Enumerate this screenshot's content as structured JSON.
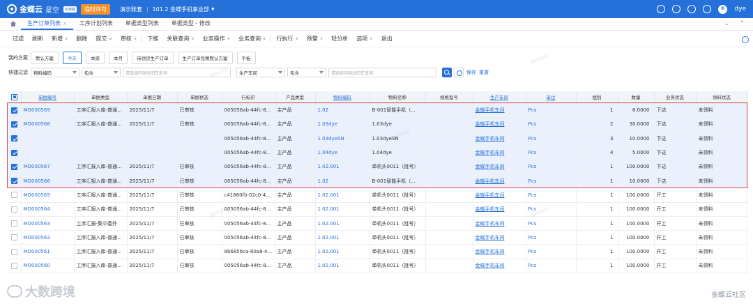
{
  "topbar": {
    "brand": "金蝶云",
    "brand_sub": "星空",
    "brand_tag": "标准版",
    "temp_badge": "临时许可",
    "account": "演示账套",
    "org": "101.2 金蝶手机事业部",
    "user": "dye"
  },
  "tabs": [
    {
      "label": "生产订单列表",
      "active": true,
      "closable": true
    },
    {
      "label": "工序计划列表",
      "active": false
    },
    {
      "label": "单据类型列表",
      "active": false
    },
    {
      "label": "单据类型 - 修改",
      "active": false
    }
  ],
  "toolbar": [
    {
      "label": "过滤"
    },
    {
      "label": "刷新"
    },
    {
      "label": "新增",
      "dropdown": true
    },
    {
      "label": "删除"
    },
    {
      "label": "提交",
      "dropdown": true
    },
    {
      "label": "审核",
      "dropdown": true
    },
    {
      "label": "下推"
    },
    {
      "label": "关联查询",
      "dropdown": true
    },
    {
      "label": "业务操作",
      "dropdown": true
    },
    {
      "label": "业务查询",
      "dropdown": true
    },
    {
      "label": "行执行",
      "dropdown": true
    },
    {
      "label": "预警",
      "dropdown": true
    },
    {
      "label": "轻分析"
    },
    {
      "label": "选项",
      "dropdown": true
    },
    {
      "label": "退出"
    }
  ],
  "plan": {
    "label": "我的方案",
    "buttons": [
      {
        "label": "默认方案",
        "active": false
      },
      {
        "label": "今天",
        "active": true
      },
      {
        "label": "本周",
        "active": false
      },
      {
        "label": "本月",
        "active": false
      },
      {
        "label": "待领货生产订单",
        "active": false
      },
      {
        "label": "生产订单竞赛默认方案",
        "active": false
      },
      {
        "label": "平板",
        "active": false
      }
    ]
  },
  "filter": {
    "label": "快捷过滤",
    "field1": "物料编码",
    "op1": "包含",
    "placeholder1": "请选择内容后回车查询",
    "field2": "生产车间",
    "op2": "包含",
    "placeholder2": "请选择内容后回车查询",
    "save": "保存",
    "reset": "重置"
  },
  "table": {
    "columns": [
      {
        "label": "",
        "link": false
      },
      {
        "label": "单据编号",
        "link": true
      },
      {
        "label": "单据类型",
        "link": false
      },
      {
        "label": "单据日期",
        "link": false
      },
      {
        "label": "单据状态",
        "link": false
      },
      {
        "label": "行标识",
        "link": false
      },
      {
        "label": "产品类型",
        "link": false
      },
      {
        "label": "物料编码",
        "link": true
      },
      {
        "label": "物料名称",
        "link": false
      },
      {
        "label": "规格型号",
        "link": false
      },
      {
        "label": "生产车间",
        "link": true
      },
      {
        "label": "单位",
        "link": true
      },
      {
        "label": "组别",
        "link": false
      },
      {
        "label": "数量",
        "link": false
      },
      {
        "label": "业务状态",
        "link": false
      },
      {
        "label": "领料状态",
        "link": false
      }
    ],
    "rows": [
      {
        "checked": true,
        "no": "MO000569",
        "type": "工序汇报入库-普通...",
        "date": "2025/11/7",
        "status": "已审核",
        "rowid": "005056ab-44fc-8...",
        "ptype": "主产品",
        "mcode": "1.02",
        "mname": "B-001智能手机（...",
        "spec": "",
        "shop": "金蝶手机车间",
        "unit": "Pcs",
        "group": "1",
        "qty": "6.0000",
        "bstatus": "下达",
        "pick": "未领料"
      },
      {
        "checked": true,
        "no": "MO000568",
        "type": "工序汇报入库-普通...",
        "date": "2025/11/7",
        "status": "已审核",
        "rowid": "005056ab-44fc-8...",
        "ptype": "主产品",
        "mcode": "1.03dye",
        "mname": "1.03dye",
        "spec": "",
        "shop": "金蝶手机车间",
        "unit": "Pcs",
        "group": "2",
        "qty": "30.0000",
        "bstatus": "下达",
        "pick": "未领料"
      },
      {
        "checked": true,
        "no": "",
        "type": "",
        "date": "",
        "status": "",
        "rowid": "005056ab-44fc-8...",
        "ptype": "主产品",
        "mcode": "1.03dyeSN",
        "mname": "1.03dyeSN",
        "spec": "",
        "shop": "金蝶手机车间",
        "unit": "Pcs",
        "group": "3",
        "qty": "10.0000",
        "bstatus": "下达",
        "pick": "未领料"
      },
      {
        "checked": true,
        "no": "",
        "type": "",
        "date": "",
        "status": "",
        "rowid": "005056ab-44fc-8...",
        "ptype": "主产品",
        "mcode": "1.04dye",
        "mname": "1.04dye",
        "spec": "",
        "shop": "金蝶手机车间",
        "unit": "Pcs",
        "group": "4",
        "qty": "5.0000",
        "bstatus": "下达",
        "pick": "未领料"
      },
      {
        "checked": true,
        "no": "MO000567",
        "type": "工序汇报入库-普通...",
        "date": "2025/11/7",
        "status": "已审核",
        "rowid": "005056ab-44fc-8...",
        "ptype": "主产品",
        "mcode": "1.02.001",
        "mname": "单机头0011（批号）",
        "spec": "",
        "shop": "金蝶手机车间",
        "unit": "Pcs",
        "group": "1",
        "qty": "100.0000",
        "bstatus": "下达",
        "pick": "未领料"
      },
      {
        "checked": true,
        "no": "MO000566",
        "type": "工序汇报入库-普通...",
        "date": "2025/11/7",
        "status": "已审核",
        "rowid": "005056ab-44fc-8...",
        "ptype": "主产品",
        "mcode": "1.02",
        "mname": "B-001智能手机（...",
        "spec": "",
        "shop": "金蝶手机车间",
        "unit": "Pcs",
        "group": "1",
        "qty": "10.0000",
        "bstatus": "下达",
        "pick": "未领料"
      },
      {
        "checked": false,
        "no": "MO000565",
        "type": "工序汇报入库-普通...",
        "date": "2025/11/7",
        "status": "已审核",
        "rowid": "c41860fb-02c0-4...",
        "ptype": "主产品",
        "mcode": "1.02.001",
        "mname": "单机头0011（批号）",
        "spec": "",
        "shop": "金蝶手机车间",
        "unit": "Pcs",
        "group": "1",
        "qty": "100.0000",
        "bstatus": "开工",
        "pick": "未领料"
      },
      {
        "checked": false,
        "no": "MO000564",
        "type": "工序汇报入库-普通...",
        "date": "2025/11/7",
        "status": "已审核",
        "rowid": "005056ab-44fc-8...",
        "ptype": "主产品",
        "mcode": "1.02.001",
        "mname": "单机头0011（批号）",
        "spec": "",
        "shop": "金蝶手机车间",
        "unit": "Pcs",
        "group": "1",
        "qty": "100.0000",
        "bstatus": "开工",
        "pick": "未领料"
      },
      {
        "checked": false,
        "no": "MO000563",
        "type": "工序汇报-集中委外",
        "date": "2025/11/7",
        "status": "已审核",
        "rowid": "005056ab-44fc-8...",
        "ptype": "主产品",
        "mcode": "1.02.001",
        "mname": "单机头0011（批号）",
        "spec": "",
        "shop": "金蝶手机车间",
        "unit": "Pcs",
        "group": "1",
        "qty": "100.0000",
        "bstatus": "开工",
        "pick": "未领料"
      },
      {
        "checked": false,
        "no": "MO000562",
        "type": "工序汇报入库-普通...",
        "date": "2025/11/7",
        "status": "已审核",
        "rowid": "005056ab-44fc-8...",
        "ptype": "主产品",
        "mcode": "1.02.001",
        "mname": "单机头0011（批号）",
        "spec": "",
        "shop": "金蝶手机车间",
        "unit": "Pcs",
        "group": "1",
        "qty": "100.0000",
        "bstatus": "开工",
        "pick": "未领料"
      },
      {
        "checked": false,
        "no": "MO000561",
        "type": "工序汇报入库-普通...",
        "date": "2025/11/7",
        "status": "已审核",
        "rowid": "8b6856ca-80a8-4...",
        "ptype": "主产品",
        "mcode": "1.02.001",
        "mname": "单机头0011（批号）",
        "spec": "",
        "shop": "金蝶手机车间",
        "unit": "Pcs",
        "group": "1",
        "qty": "100.0000",
        "bstatus": "开工",
        "pick": "未领料"
      },
      {
        "checked": false,
        "no": "MO000560",
        "type": "工序汇报入库-普通...",
        "date": "2025/11/7",
        "status": "已审核",
        "rowid": "005056ab-44fc-8...",
        "ptype": "主产品",
        "mcode": "1.02.001",
        "mname": "单机头0011（批号）",
        "spec": "",
        "shop": "金蝶手机车间",
        "unit": "Pcs",
        "group": "1",
        "qty": "100.0000",
        "bstatus": "开工",
        "pick": "未领料"
      }
    ]
  },
  "watermark": "临时许可",
  "footer": {
    "left": "大数跨境",
    "right": "金蝶云社区"
  },
  "colors": {
    "primary": "#2671d9",
    "badge": "#f5922b",
    "selection_outline": "#e0474c",
    "selected_row": "#eaf1fd"
  }
}
